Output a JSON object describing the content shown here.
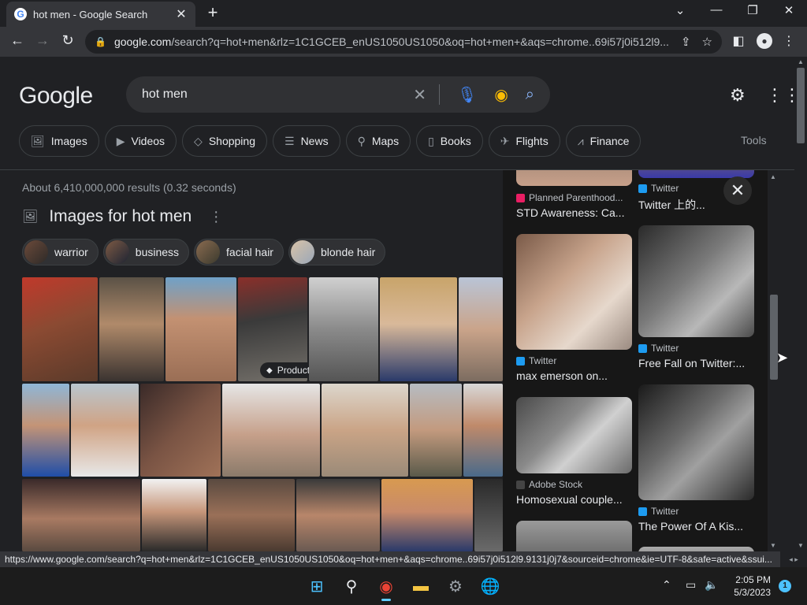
{
  "browser": {
    "tab_title": "hot men - Google Search",
    "favicon": "G",
    "new_tab": "+",
    "url_domain": "google.com",
    "url_rest": "/search?q=hot+men&rlz=1C1GCEB_enUS1050US1050&oq=hot+men+&aqs=chrome..69i57j0i512l9....",
    "status_url": "https://www.google.com/search?q=hot+men&rlz=1C1GCEB_enUS1050US1050&oq=hot+men+&aqs=chrome..69i57j0i512l9.9131j0j7&sourceid=chrome&ie=UTF-8&safe=active&ssui..."
  },
  "header": {
    "logo": "Google",
    "query": "hot men"
  },
  "filters": [
    {
      "label": "Images",
      "icon": "image-icon",
      "glyph": "🖼"
    },
    {
      "label": "Videos",
      "icon": "video-icon",
      "glyph": "▶"
    },
    {
      "label": "Shopping",
      "icon": "tag-icon",
      "glyph": "◇"
    },
    {
      "label": "News",
      "icon": "news-icon",
      "glyph": "☰"
    },
    {
      "label": "Maps",
      "icon": "pin-icon",
      "glyph": "⚲"
    },
    {
      "label": "Books",
      "icon": "book-icon",
      "glyph": "▯"
    },
    {
      "label": "Flights",
      "icon": "plane-icon",
      "glyph": "✈"
    },
    {
      "label": "Finance",
      "icon": "chart-icon",
      "glyph": "⩘"
    }
  ],
  "tools_label": "Tools",
  "results": {
    "stats": "About 6,410,000,000 results (0.32 seconds)",
    "images_title": "Images for hot men",
    "related": [
      "warrior",
      "business",
      "facial hair",
      "blonde hair"
    ],
    "product_badge": "Product"
  },
  "panel": {
    "cards": [
      {
        "source": "Planned Parenthood...",
        "title": "STD Awareness: Ca...",
        "source_color": "#e91e63"
      },
      {
        "source": "Twitter",
        "title": "Twitter 上的...",
        "source_color": "#1d9bf0"
      },
      {
        "source": "Twitter",
        "title": "max emerson on...",
        "source_color": "#1d9bf0"
      },
      {
        "source": "Twitter",
        "title": "Free Fall on Twitter:...",
        "source_color": "#1d9bf0"
      },
      {
        "source": "Adobe Stock",
        "title": "Homosexual couple...",
        "source_color": "#444444"
      },
      {
        "source": "Twitter",
        "title": "The Power Of A Kis...",
        "source_color": "#1d9bf0"
      }
    ]
  },
  "taskbar": {
    "time": "2:05 PM",
    "date": "5/3/2023",
    "notifications": "1"
  }
}
